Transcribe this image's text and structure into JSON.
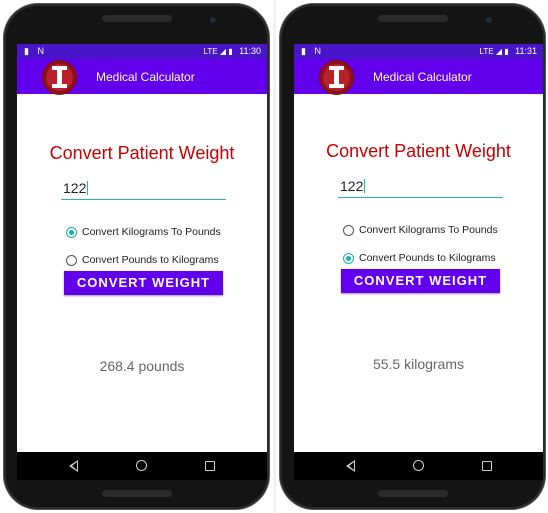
{
  "screens": [
    {
      "status": {
        "left_icons": "▮ N",
        "time": "11:30",
        "indicators": "LTE ◢ ▮"
      },
      "app_title": "Medical Calculator",
      "heading": "Convert Patient Weight",
      "input_value": "122",
      "radios": [
        {
          "label": "Convert Kilograms To Pounds",
          "selected": true
        },
        {
          "label": "Convert Pounds to Kilograms",
          "selected": false
        }
      ],
      "button_label": "CONVERT WEIGHT",
      "result": "268.4 pounds"
    },
    {
      "status": {
        "left_icons": "▮ N",
        "time": "11:31",
        "indicators": "LTE ◢ ▮"
      },
      "app_title": "Medical Calculator",
      "heading": "Convert Patient Weight",
      "input_value": "122",
      "radios": [
        {
          "label": "Convert Kilograms To Pounds",
          "selected": false
        },
        {
          "label": "Convert Pounds to Kilograms",
          "selected": true
        }
      ],
      "button_label": "CONVERT WEIGHT",
      "result": "55.5 kilograms"
    }
  ],
  "colors": {
    "app_bar": "#6200ee",
    "status_bar": "#4a14c8",
    "heading": "#c80000",
    "accent": "#11b2aa"
  },
  "icons": {
    "app_logo": "red-circle-I-logo",
    "nav": [
      "back-icon",
      "home-icon",
      "recents-icon"
    ]
  }
}
